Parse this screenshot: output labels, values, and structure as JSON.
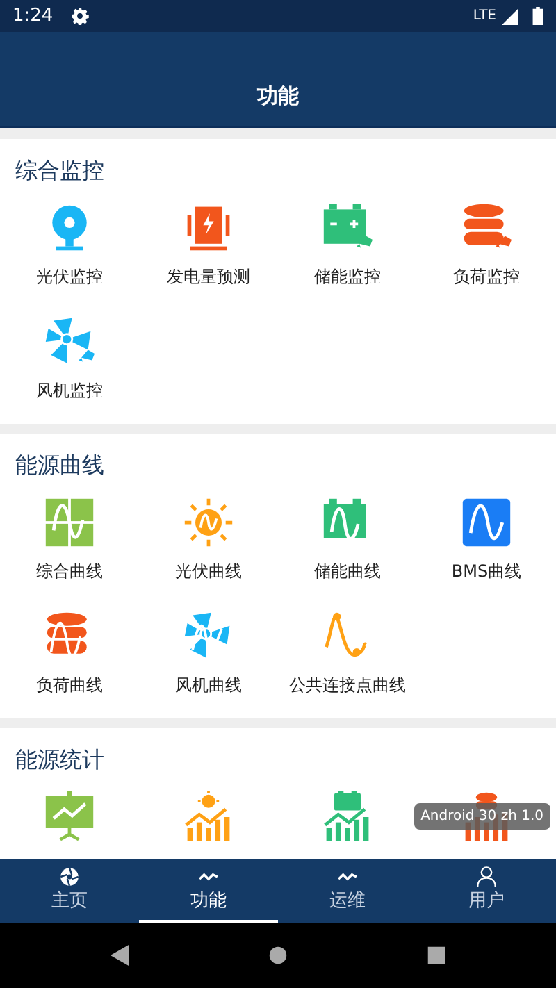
{
  "status_bar": {
    "time": "1:24",
    "network": "LTE"
  },
  "app_bar": {
    "title": "功能"
  },
  "sections": [
    {
      "title": "综合监控",
      "items": [
        {
          "kind": "webcam",
          "label": "光伏监控"
        },
        {
          "kind": "generator",
          "label": "发电量预测"
        },
        {
          "kind": "battery-cam",
          "label": "储能监控"
        },
        {
          "kind": "database-cam",
          "label": "负荷监控"
        },
        {
          "kind": "fan-cam",
          "label": "风机监控"
        }
      ]
    },
    {
      "title": "能源曲线",
      "items": [
        {
          "kind": "grid-curve",
          "label": "综合曲线"
        },
        {
          "kind": "sun-curve",
          "label": "光伏曲线"
        },
        {
          "kind": "battery-curve",
          "label": "储能曲线"
        },
        {
          "kind": "square-curve",
          "label": "BMS曲线"
        },
        {
          "kind": "database-curve",
          "label": "负荷曲线"
        },
        {
          "kind": "fan-curve",
          "label": "风机曲线"
        },
        {
          "kind": "point-curve",
          "label": "公共连接点曲线"
        }
      ]
    },
    {
      "title": "能源统计",
      "items": [
        {
          "kind": "board-chart"
        },
        {
          "kind": "sun-bars"
        },
        {
          "kind": "battery-bars"
        },
        {
          "kind": "database-bars"
        }
      ]
    }
  ],
  "toast": "Android 30 zh 1.0",
  "tabs": [
    {
      "kind": "aperture",
      "label": "主页",
      "selected": false
    },
    {
      "kind": "zigzag",
      "label": "功能",
      "selected": true
    },
    {
      "kind": "zigzag",
      "label": "运维",
      "selected": false
    },
    {
      "kind": "person",
      "label": "用户",
      "selected": false
    }
  ]
}
